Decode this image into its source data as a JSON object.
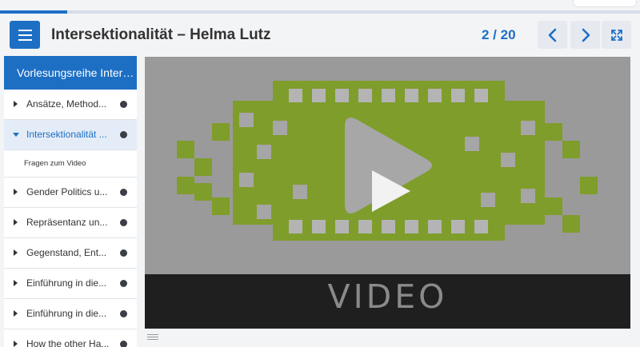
{
  "progress": {
    "current": 2,
    "total": 20,
    "fraction": 0.105
  },
  "header": {
    "title": "Intersektionalität – Helma Lutz",
    "counter": "2 / 20",
    "menu_icon": "hamburger-icon",
    "prev_icon": "chevron-left-icon",
    "next_icon": "chevron-right-icon",
    "fullscreen_icon": "fullscreen-expand-icon"
  },
  "sidebar": {
    "heading": "Vorlesungsreihe Interdi...",
    "items": [
      {
        "label": "Ansätze, Method...",
        "active": false
      },
      {
        "label": "Intersektionalität ...",
        "active": true
      },
      {
        "label": "Gender Politics u...",
        "active": false
      },
      {
        "label": "Repräsentanz un...",
        "active": false
      },
      {
        "label": "Gegenstand, Ent...",
        "active": false
      },
      {
        "label": "Einführung in die...",
        "active": false
      },
      {
        "label": "Einführung in die...",
        "active": false
      },
      {
        "label": "How the other Ha...",
        "active": false
      }
    ],
    "subitem": "Fragen zum Video"
  },
  "video": {
    "caption": "VIDEO",
    "play_icon": "play-icon",
    "colors": {
      "film": "#7f9d2b",
      "background": "#9a9a9a",
      "bar": "#1f1f1f"
    }
  },
  "colors": {
    "accent": "#1d6fc4",
    "active_bg": "#e4ecf7"
  }
}
